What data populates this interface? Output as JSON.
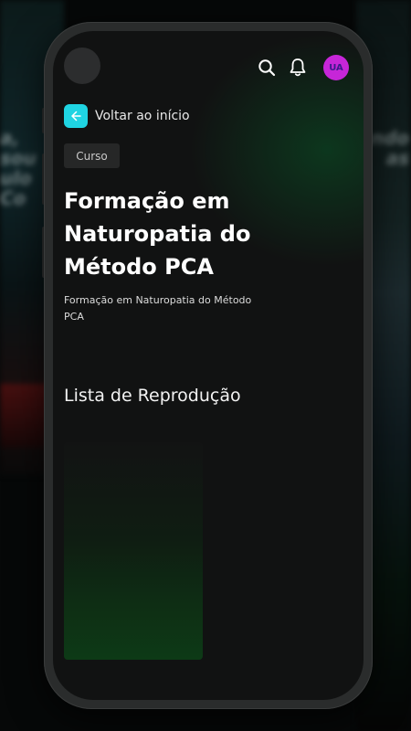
{
  "background": {
    "left_text": "a, sou\nulo Co",
    "right_text": "ndo\nas"
  },
  "header": {
    "search_icon": "search-icon",
    "notification_icon": "bell-icon",
    "avatar_initials": "UA"
  },
  "back": {
    "label": "Voltar ao início",
    "icon": "arrow-left-icon"
  },
  "content": {
    "badge": "Curso",
    "title": "Formação em Naturopatia do Método PCA",
    "subtitle": "Formação em Naturopatia do Método PCA",
    "playlist_heading": "Lista de Reprodução"
  },
  "colors": {
    "accent": "#1fd4e2",
    "avatar": "#c626d8",
    "screen_bg": "#111212"
  }
}
